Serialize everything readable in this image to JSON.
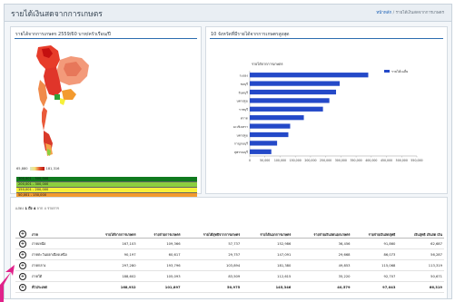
{
  "header": {
    "title": "รายได้เงินสดจากการเกษตร",
    "breadcrumb_home": "หน้าหลัก",
    "breadcrumb_current": "รายได้เงินสดจากการเกษตร"
  },
  "map_panel": {
    "title": "รายได้จากการเกษตร 2559/60 บาท/ครัวเรือน/ปี",
    "legend_min": "65,880",
    "legend_max": "181,316",
    "legend_rows": [
      {
        "label": "300,001 - 500,000",
        "color": "#0f7a1e"
      },
      {
        "label": "200,001 - 300,000",
        "color": "#8ccf3f"
      },
      {
        "label": "150,001 - 200,000",
        "color": "#f6f03a"
      },
      {
        "label": "50,001 - 150,000",
        "color": "#f29a2e"
      },
      {
        "label": "40,001 - 100,000",
        "color": "#e52420"
      },
      {
        "label": "",
        "color": "#c41010"
      }
    ]
  },
  "chart_panel": {
    "title": "10 จังหวัดที่มีรายได้จากการเกษตรสูงสุด"
  },
  "chart_data": {
    "type": "bar",
    "orientation": "horizontal",
    "title": "รายได้จากการเกษตร",
    "categories": [
      "สุพรรณบุรี",
      "กาญจนบุรี",
      "นครปฐม",
      "ฉะเชิงเทรา",
      "ตราด",
      "ราชบุรี",
      "นครปฐม",
      "จันทบุรี",
      "ชลบุรี",
      "ระยอง"
    ],
    "values": [
      71000,
      90000,
      127000,
      133000,
      178000,
      241000,
      262000,
      284000,
      296000,
      390000
    ],
    "series": [
      {
        "name": "รายได้เฉลี่ย",
        "color": "#2449c8"
      }
    ],
    "xlim": [
      0,
      550000
    ],
    "xticks": [
      "0",
      "50,000",
      "100,000",
      "150,000",
      "200,000",
      "250,000",
      "300,000",
      "350,000",
      "400,000",
      "450,000",
      "500,000",
      "550,000"
    ],
    "legend_position": "top-right",
    "grid": false
  },
  "table_panel": {
    "showing_prefix": "แสดง",
    "showing_range": "1 ถึง 4",
    "showing_suffix": "จาก 4 รายการ",
    "headers": [
      "ภาค",
      "รายได้จากการเกษตร",
      "รายจ่ายการเกษตร",
      "รายได้สุทธิจากการเกษตร",
      "รายได้นอกการเกษตร",
      "รายจ่ายเงินสดนอกเกษตร",
      "รายจ่ายเงินสดสุทธิ",
      "เงินสุทธิ เงินสด เงิน"
    ],
    "rows": [
      [
        "ภาคเหนือ",
        "167,103",
        "109,366",
        "57,737",
        "152,986",
        "36,456",
        "91,860",
        "62,687"
      ],
      [
        "ภาคตะวันออกเฉียงเหนือ",
        "90,197",
        "60,617",
        "29,757",
        "147,091",
        "29,668",
        "86,073",
        "56,287"
      ],
      [
        "ภาคกลาง",
        "297,280",
        "193,796",
        "103,894",
        "181,380",
        "49,853",
        "115,068",
        "113,319"
      ],
      [
        "ภาคใต้",
        "188,602",
        "105,093",
        "83,509",
        "112,615",
        "35,220",
        "92,707",
        "50,671"
      ]
    ],
    "total": [
      "ทั่วประเทศ",
      "168,932",
      "101,897",
      "50,975",
      "145,346",
      "40,579",
      "97,043",
      "66,319"
    ]
  }
}
